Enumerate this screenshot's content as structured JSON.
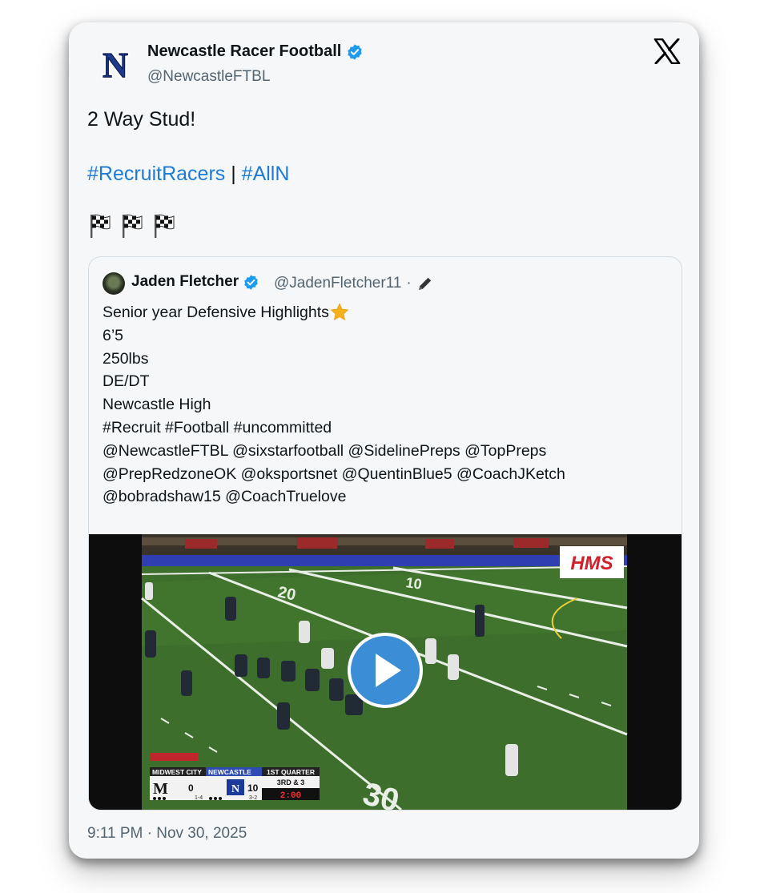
{
  "tweet": {
    "author": {
      "display_name": "Newcastle Racer Football",
      "handle": "@NewcastleFTBL",
      "avatar_letter": "N",
      "verified": true
    },
    "text": "2 Way Stud!",
    "hashtag_1": "#RecruitRacers",
    "separator": " | ",
    "hashtag_2": "#AllN",
    "emoji": [
      "chequered-flag",
      "chequered-flag",
      "chequered-flag"
    ],
    "timestamp": "9:11 PM · Nov 30, 2025"
  },
  "quoted_tweet": {
    "author": {
      "display_name": "Jaden Fletcher",
      "handle": "@JadenFletcher11",
      "dot": "·",
      "verified": true
    },
    "title_line": "Senior year Defensive Highlights",
    "lines": [
      "6’5",
      "250lbs",
      "DE/DT",
      "Newcastle High",
      "#Recruit #Football #uncommitted",
      "@NewcastleFTBL @sixstarfootball @SidelinePreps @TopPreps",
      "@PrepRedzoneOK @oksportsnet @QuentinBlue5 @CoachJKetch",
      "@bobradshaw15 @CoachTruelove"
    ],
    "video": {
      "watermark": "HMS",
      "field_numbers": [
        "20",
        "10",
        "30"
      ],
      "scorebug": {
        "away_team": "MIDWEST CITY",
        "away_letter": "M",
        "away_score": "0",
        "away_timeouts": "1-4",
        "home_team": "NEWCASTLE",
        "home_letter": "N",
        "home_score": "10",
        "home_timeouts": "3-2",
        "quarter": "1ST QUARTER",
        "down_distance": "3RD & 3",
        "clock": "2:00"
      }
    }
  },
  "colors": {
    "card_bg": "#f5f7f8",
    "link": "#1d7bd6",
    "verified": "#1d9bf0",
    "text": "#0f1419",
    "muted": "#536471",
    "field": "#3d6e2c",
    "play_button": "#3b8dd6"
  }
}
